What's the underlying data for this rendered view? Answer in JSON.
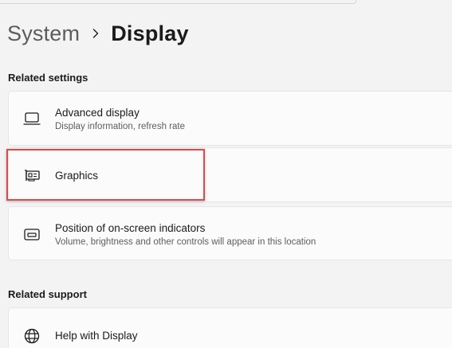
{
  "breadcrumb": {
    "parent": "System",
    "current": "Display"
  },
  "related_settings": {
    "title": "Related settings",
    "items": [
      {
        "label": "Advanced display",
        "description": "Display information, refresh rate",
        "icon": "monitor-icon"
      },
      {
        "label": "Graphics",
        "description": "",
        "icon": "graphics-card-icon"
      },
      {
        "label": "Position of on-screen indicators",
        "description": "Volume, brightness and other controls will appear in this location",
        "icon": "on-screen-indicator-icon"
      }
    ]
  },
  "related_support": {
    "title": "Related support",
    "items": [
      {
        "label": "Help with Display",
        "icon": "globe-icon"
      }
    ]
  },
  "colors": {
    "highlight": "#e0474c",
    "background": "#f3f3f3",
    "card": "#fbfbfb"
  }
}
